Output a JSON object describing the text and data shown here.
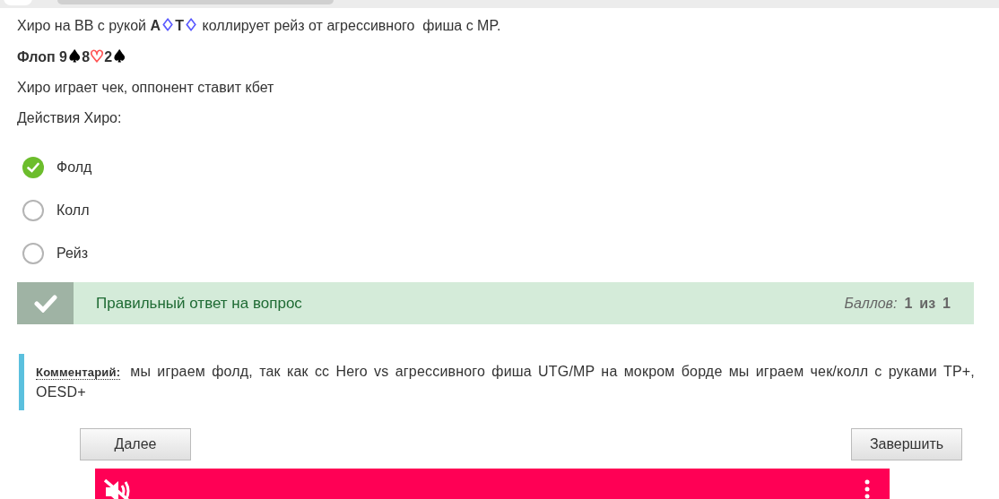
{
  "question": {
    "lines": [
      [
        {
          "kind": "plain",
          "text": "Хиро на BB с рукой "
        },
        {
          "kind": "bold",
          "text": "A"
        },
        {
          "kind": "suit",
          "text": "♢",
          "color": "#5b5bff"
        },
        {
          "kind": "bold",
          "text": "T"
        },
        {
          "kind": "suit",
          "text": "♢",
          "color": "#5b5bff"
        },
        {
          "kind": "plain",
          "text": " коллирует рейз от агрессивного  фиша с MP."
        }
      ],
      [
        {
          "kind": "bold",
          "text": "Флоп 9"
        },
        {
          "kind": "suit",
          "text": "♠",
          "color": "#000000"
        },
        {
          "kind": "bold",
          "text": "8"
        },
        {
          "kind": "suit",
          "text": "♡",
          "color": "#ff5555"
        },
        {
          "kind": "bold",
          "text": "2"
        },
        {
          "kind": "suit",
          "text": "♠",
          "color": "#000000"
        }
      ],
      [
        {
          "kind": "plain",
          "text": "Хиро играет чек, оппонент ставит кбет"
        }
      ],
      [
        {
          "kind": "plain",
          "text": "Действия Хиро:"
        }
      ]
    ]
  },
  "options": [
    {
      "label": "Фолд",
      "selected": true
    },
    {
      "label": "Колл",
      "selected": false
    },
    {
      "label": "Рейз",
      "selected": false
    }
  ],
  "feedback": {
    "correct": true,
    "message": "Правильный ответ на вопрос",
    "score_label": "Баллов:",
    "score": "1",
    "of": "из",
    "max": "1"
  },
  "comment": {
    "label": "Комментарий:",
    "text": "мы играем фолд, так как cc Hero vs агрессивного фиша UTG/MP на мокром борде мы играем чек/колл с руками TP+, OESD+"
  },
  "buttons": {
    "next": "Далее",
    "finish": "Завершить"
  }
}
